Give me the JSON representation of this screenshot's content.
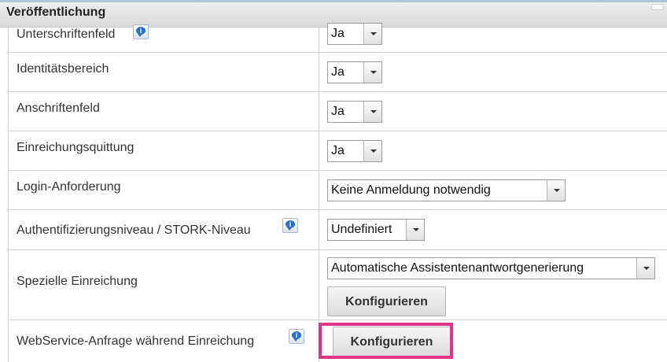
{
  "section": {
    "title": "Veröffentlichung"
  },
  "rows": [
    {
      "label": "Unterschriftenfeld",
      "value": "Ja",
      "has_info": true
    },
    {
      "label": "Identitätsbereich",
      "value": "Ja"
    },
    {
      "label": "Anschriftenfeld",
      "value": "Ja"
    },
    {
      "label": "Einreichungsquittung",
      "value": "Ja"
    },
    {
      "label": "Login-Anforderung",
      "value": "Keine Anmeldung notwendig"
    },
    {
      "label": "Authentifizierungsniveau / STORK-Niveau",
      "value": "Undefiniert",
      "has_info": true
    },
    {
      "label": "Spezielle Einreichung",
      "value": "Automatische Assistentenantwortgenerierung",
      "button": "Konfigurieren"
    },
    {
      "label": "WebService-Anfrage während Einreichung",
      "button": "Konfigurieren",
      "has_info": true,
      "highlighted": true
    }
  ],
  "colors": {
    "highlight": "#e0348a",
    "info_icon": "#2a6fd0",
    "header_bg": "#e4e4e4"
  }
}
